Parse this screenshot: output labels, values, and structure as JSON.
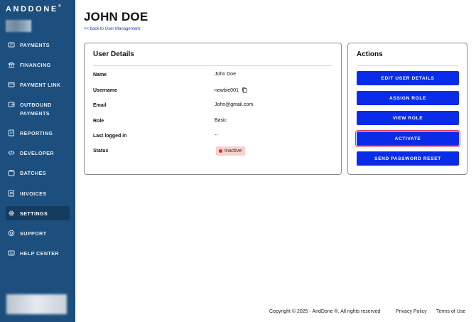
{
  "brand": {
    "logo_text": "ANDDONE",
    "logo_mark": "®"
  },
  "sidebar": {
    "items": [
      {
        "label": "PAYMENTS",
        "icon": "payments-icon"
      },
      {
        "label": "FINANCING",
        "icon": "bank-icon"
      },
      {
        "label": "PAYMENT LINK",
        "icon": "link-card-icon"
      },
      {
        "label_line1": "OUTBOUND",
        "label_line2": "PAYMENTS",
        "icon": "outbound-icon"
      },
      {
        "label": "REPORTING",
        "icon": "report-icon"
      },
      {
        "label": "DEVELOPER",
        "icon": "code-icon"
      },
      {
        "label": "BATCHES",
        "icon": "batches-icon"
      },
      {
        "label": "INVOICES",
        "icon": "invoice-icon"
      },
      {
        "label": "SETTINGS",
        "icon": "gear-icon",
        "active": true
      },
      {
        "label": "SUPPORT",
        "icon": "support-icon"
      },
      {
        "label": "HELP CENTER",
        "icon": "help-icon"
      }
    ]
  },
  "header": {
    "title": "JOHN DOE",
    "back_link": "<< back to User Management"
  },
  "details": {
    "heading": "User Details",
    "rows": [
      {
        "label": "Name",
        "value": "John Doe"
      },
      {
        "label": "Username",
        "value": "newbie001"
      },
      {
        "label": "Email",
        "value": "John@gmail.com"
      },
      {
        "label": "Role",
        "value": "Basic"
      },
      {
        "label": "Last logged in",
        "value": "--"
      },
      {
        "label": "Status",
        "value": "Inactive"
      }
    ]
  },
  "actions": {
    "heading": "Actions",
    "buttons": [
      "EDIT USER DETAILS",
      "ASSIGN ROLE",
      "VIEW ROLE",
      "ACTIVATE",
      "SEND PASSWORD RESET"
    ]
  },
  "footer": {
    "copyright": "Copyright © 2025 - AndDone ®. All rights reserved",
    "privacy": "Privacy Policy",
    "terms": "Terms of Use"
  },
  "colors": {
    "sidebar": "#1c4f7e",
    "sidebar_active": "#143b60",
    "button": "#0a2ce8",
    "focus_outline": "#d9375a",
    "status_badge_bg": "#f6d2cc",
    "status_dot": "#d42a2a"
  }
}
